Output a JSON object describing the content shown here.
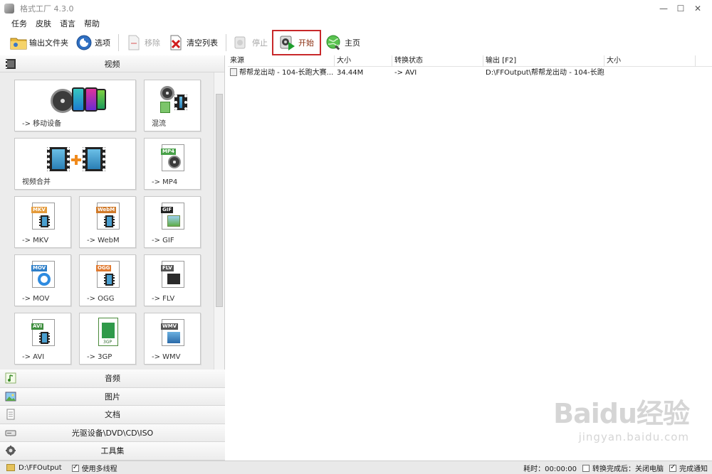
{
  "window": {
    "title": "格式工厂 4.3.0",
    "controls": [
      "—",
      "☐",
      "✕"
    ]
  },
  "menu": [
    "任务",
    "皮肤",
    "语言",
    "帮助"
  ],
  "toolbar": {
    "output_folder": "输出文件夹",
    "options": "选项",
    "remove": "移除",
    "clear_list": "清空列表",
    "stop": "停止",
    "start": "开始",
    "home": "主页"
  },
  "categories": {
    "video": "视频",
    "audio": "音频",
    "image": "图片",
    "document": "文档",
    "optical": "光驱设备\\DVD\\CD\\ISO",
    "tools": "工具集"
  },
  "tiles": {
    "mobile": "-> 移动设备",
    "mux": "混流",
    "merge": "视频合并",
    "mp4": "-> MP4",
    "mkv": "-> MKV",
    "webm": "-> WebM",
    "gif": "-> GIF",
    "mov": "-> MOV",
    "ogg": "-> OGG",
    "flv": "-> FLV",
    "avi": "-> AVI",
    "3gp": "-> 3GP",
    "wmv": "-> WMV"
  },
  "tile_tags": {
    "mp4": "MP4",
    "mkv": "MKV",
    "webm": "WebM",
    "gif": "GIF",
    "mov": "MOV",
    "ogg": "OGG",
    "flv": "FLV",
    "avi": "AVI",
    "3gp": "3GP",
    "wmv": "WMV"
  },
  "list": {
    "columns": [
      "来源",
      "大小",
      "转换状态",
      "输出 [F2]",
      "大小"
    ],
    "rows": [
      {
        "source": "帮帮龙出动 - 104-长跑大赛...",
        "size": "34.44M",
        "status": "-> AVI",
        "output": "D:\\FFOutput\\帮帮龙出动 - 104-长跑...",
        "out_size": ""
      }
    ]
  },
  "status": {
    "output_path": "D:\\FFOutput",
    "multithread": "使用多线程",
    "elapsed": "耗时：00:00:00",
    "after_done": "转换完成后：关闭电脑",
    "notify": "完成通知"
  },
  "watermark": {
    "main": "Baidu经验",
    "sub": "jingyan.baidu.com"
  },
  "colors": {
    "highlight_border": "#c8282a",
    "start_label": "#8a2e10"
  }
}
